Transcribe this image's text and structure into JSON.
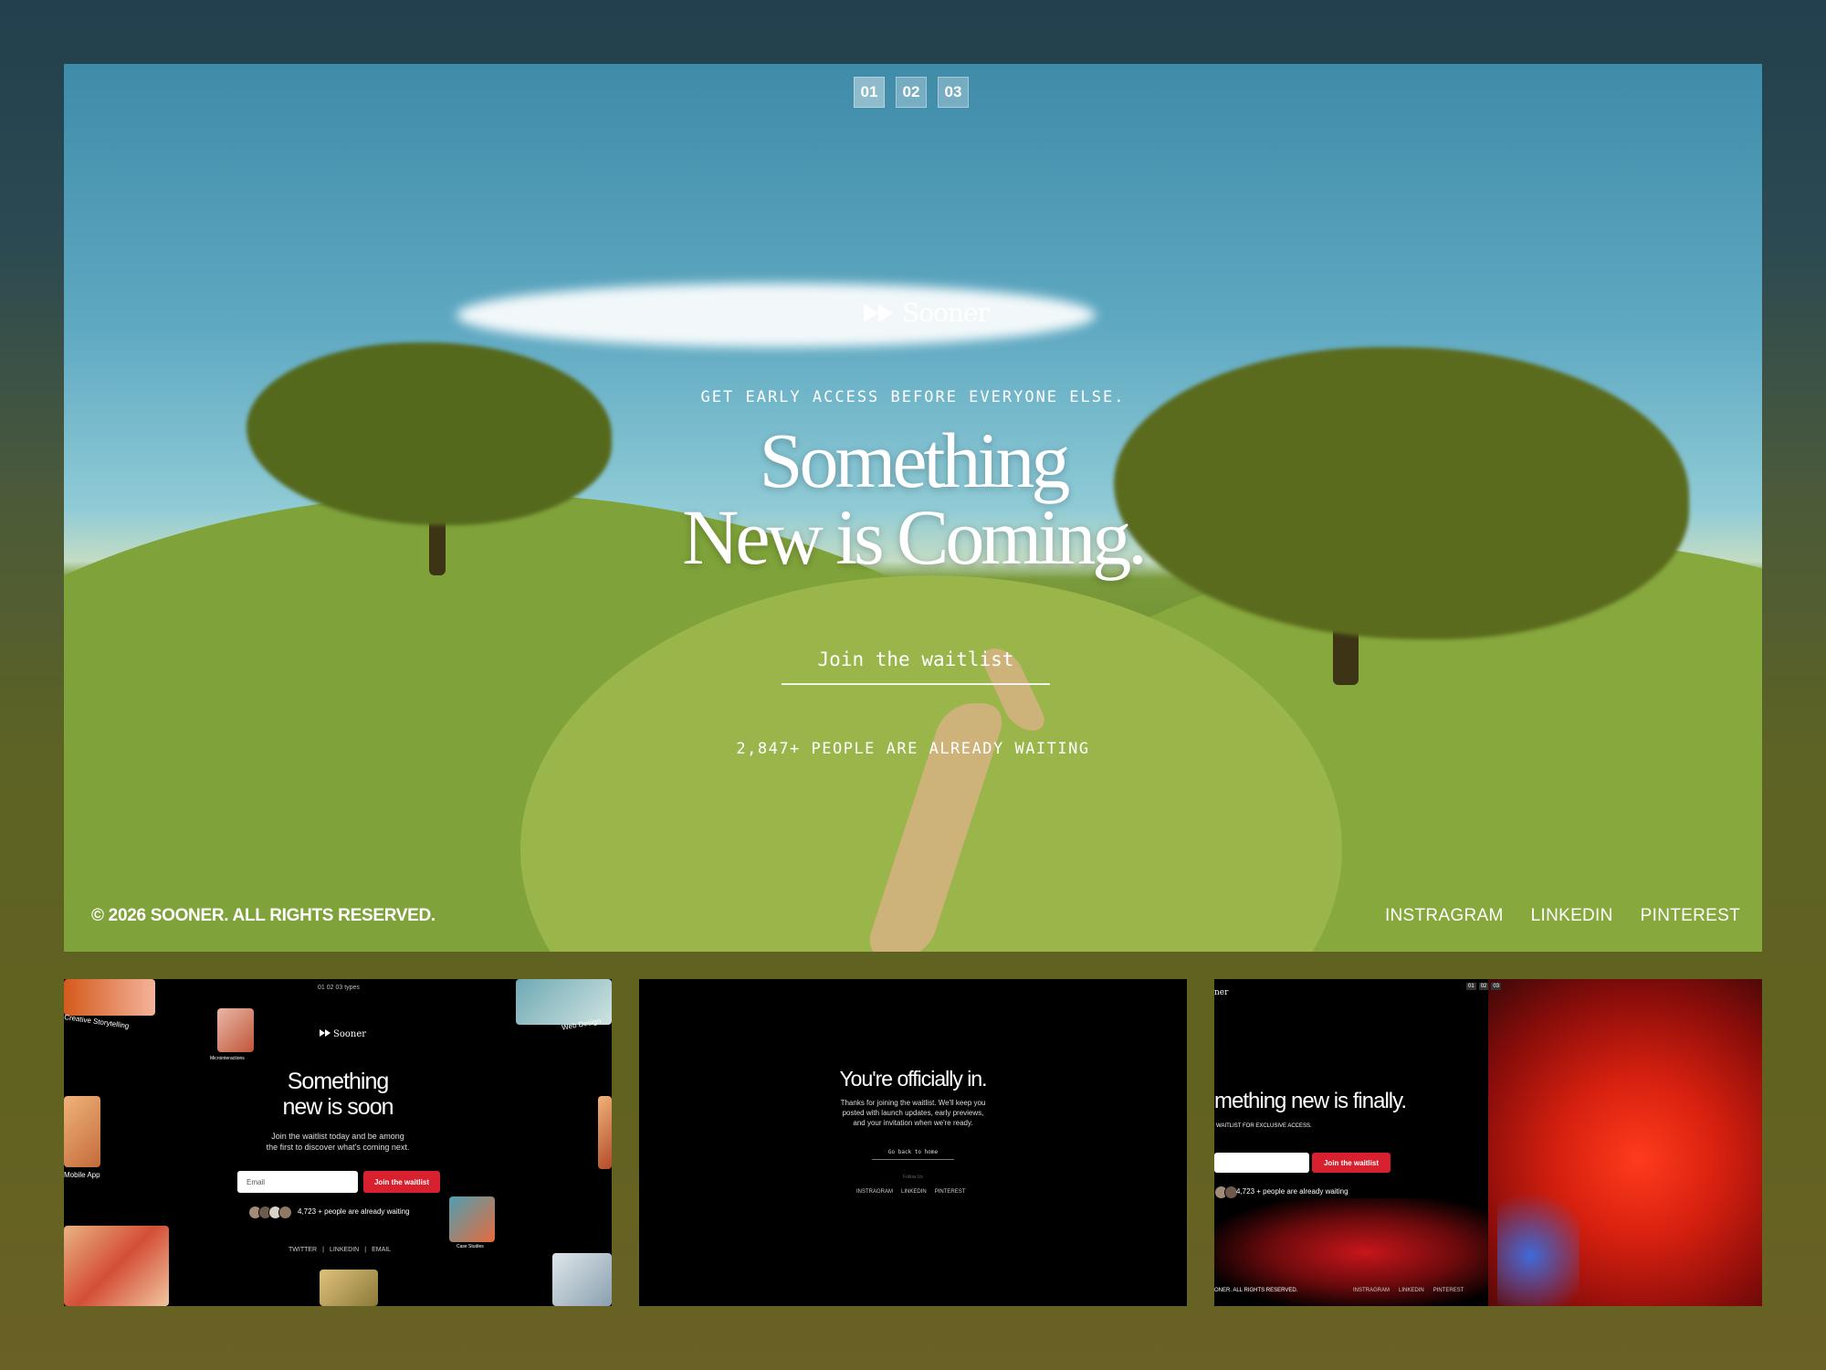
{
  "hero": {
    "slide_tabs": [
      "01",
      "02",
      "03"
    ],
    "logo_text": "Sooner",
    "eyebrow": "GET EARLY ACCESS BEFORE EVERYONE ELSE.",
    "headline_line1": "Something",
    "headline_line2": "New is Coming.",
    "cta_label": "Join the waitlist",
    "waiting_text": "2,847+ PEOPLE ARE ALREADY WAITING",
    "copyright": "© 2026 SOONER. ALL RIGHTS RESERVED.",
    "socials": [
      "INSTRAGRAM",
      "LINKEDIN",
      "PINTEREST"
    ]
  },
  "thumb1": {
    "logo_text": "Sooner",
    "top_label": "01 02 03 types",
    "card_labels": [
      "Creative Storytelling",
      "Web Design",
      "Mobile App",
      "Case Studies",
      "Microinteractions"
    ],
    "title_line1": "Something",
    "title_line2": "new is soon",
    "subtitle_line1": "Join the waitlist today and be among",
    "subtitle_line2": "the first to discover what's coming next.",
    "email_placeholder": "Email",
    "button_label": "Join the waitlist",
    "waiting_text": "4,723 + people are already waiting",
    "links": [
      "TWITTER",
      "|",
      "LINKEDIN",
      "|",
      "EMAIL"
    ]
  },
  "thumb2": {
    "title": "You're officially in.",
    "body_line1": "Thanks for joining the waitlist. We'll keep you",
    "body_line2": "posted with launch updates, early previews,",
    "body_line3": "and your invitation when we're ready.",
    "back_label": "Go back to home",
    "follow_label": "Follow Us",
    "links": [
      "INSTRAGRAM",
      "LINKEDIN",
      "PINTEREST"
    ]
  },
  "thumb3": {
    "logo_fragment": "ner",
    "tabs": [
      "01",
      "02",
      "03"
    ],
    "title": "mething new is finally.",
    "subtitle": "WAITLIST FOR EXCLUSIVE ACCESS.",
    "button_label": "Join the waitlist",
    "waiting_text": "4,723 + people are already waiting",
    "copyright": "ONER. ALL RIGHTS RESERVED.",
    "links": [
      "INSTRAGRAM",
      "LINKEDIN",
      "PINTEREST"
    ]
  },
  "colors": {
    "accent_red": "#d8202f",
    "sky": "#5fa9c2",
    "grass": "#6c8f2a"
  }
}
